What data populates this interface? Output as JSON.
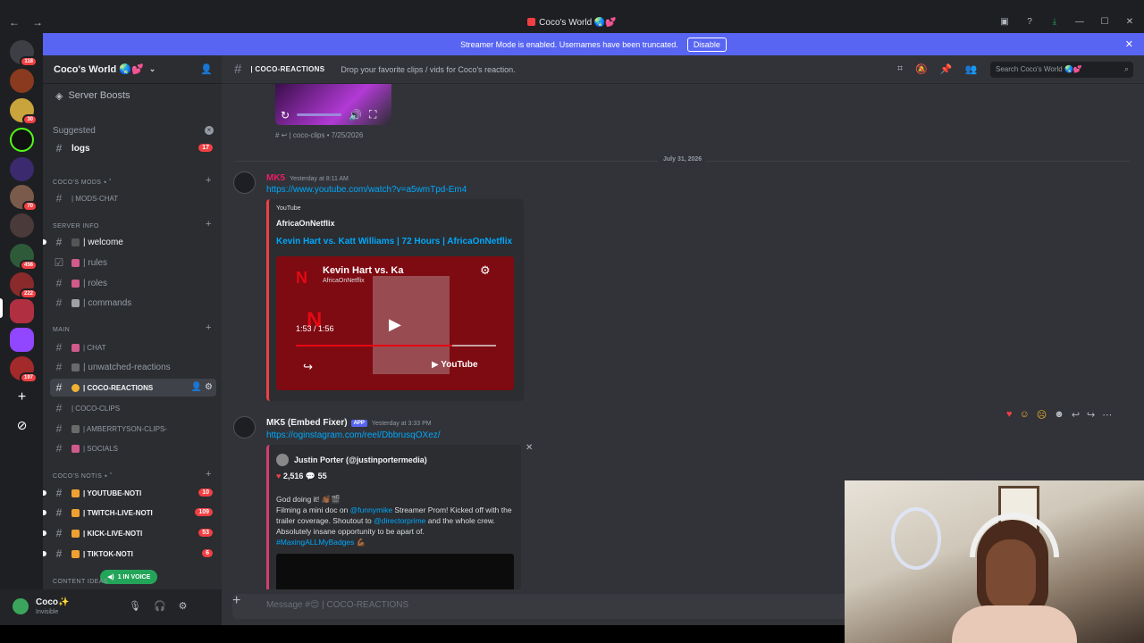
{
  "window": {
    "title": "Coco's World 🌏💕",
    "nav_back": "←",
    "nav_forward": "→"
  },
  "banner": {
    "text": "Streamer Mode is enabled. Usernames have been truncated.",
    "button": "Disable"
  },
  "rail": {
    "badges": [
      "118",
      "30",
      "70",
      "456",
      "222",
      "197"
    ]
  },
  "server": {
    "name": "Coco's World 🌏💕",
    "boosts": "Server Boosts",
    "suggested_label": "Suggested",
    "suggested_channel": "logs",
    "suggested_count": "17"
  },
  "categories": {
    "mods": "COCO'S MODS ⭑ ˚",
    "info": "SERVER INFO",
    "main": "MAIN",
    "notis": "COCO'S NOTIS ⭑ ˚",
    "ideas": "CONTENT IDEAS"
  },
  "channels": {
    "mods_chat": "| MODS-CHAT",
    "welcome": "| welcome",
    "rules": "| rules",
    "roles": "| roles",
    "commands": "| commands",
    "chat": "| CHAT",
    "unwatched": "| unwatched-reactions",
    "coco_reactions": "| COCO-REACTIONS",
    "coco_clips": "| COCO-CLIPS",
    "amberrtyson": "| AMBERRTYSON-CLIPS-",
    "socials": "| SOCIALS",
    "youtube": "| YOUTUBE-NOTI",
    "youtube_count": "10",
    "twitch": "| TWITCH-LIVE-NOTI",
    "twitch_count": "109",
    "kick": "| KICK-LIVE-NOTI",
    "kick_count": "53",
    "tiktok": "| TIKTOK-NOTI",
    "tiktok_count": "6",
    "voice_pill": "1 IN VOICE"
  },
  "user": {
    "name": "Coco✨",
    "status": "Invisible"
  },
  "header": {
    "channel": "| COCO-REACTIONS",
    "topic": "Drop your favorite clips / vids for Coco's reaction.",
    "search_placeholder": "Search Coco's World 🌏💕"
  },
  "messages": {
    "prev_ref": "# ↩ | coco-clips • 7/25/2026",
    "date_divider": "July 31, 2026",
    "msg1": {
      "author": "MK5",
      "author_color": "#e91e63",
      "time": "Yesterday at 8:11 AM",
      "link": "https://www.youtube.com/watch?v=a5wmTpd-Em4",
      "embed_provider": "YouTube",
      "embed_author": "AfricaOnNetflix",
      "embed_title": "Kevin Hart vs. Katt Williams | 72 Hours | AfricaOnNetflix",
      "player_title": "Kevin Hart vs. Ka",
      "player_channel": "AfricaOnNetflix",
      "player_time": "1:53 / 1:56",
      "player_brand": "YouTube"
    },
    "msg2": {
      "author": "MK5 (Embed Fixer)",
      "app_tag": "APP",
      "time": "Yesterday at 3:33 PM",
      "link": "https://oginstagram.com/reel/DbbrusqOXez/",
      "ig_author": "Justin Porter (@justinportermedia)",
      "likes": "2,516",
      "comments": "55",
      "line1": "God doing it! 👏🏾🎬",
      "line2_a": "Filming a mini doc on ",
      "mention1": "@funnymike",
      "line2_b": " Streamer Prom! Kicked off with the trailer coverage. Shoutout to ",
      "mention2": "@directorprime",
      "line2_c": " and the whole crew. Absolutely insane opportunity to be apart of.",
      "hashtag": "#MaxingALLMyBadges 💪🏾"
    }
  },
  "composer": {
    "placeholder": "Message #😊 | COCO-REACTIONS"
  }
}
